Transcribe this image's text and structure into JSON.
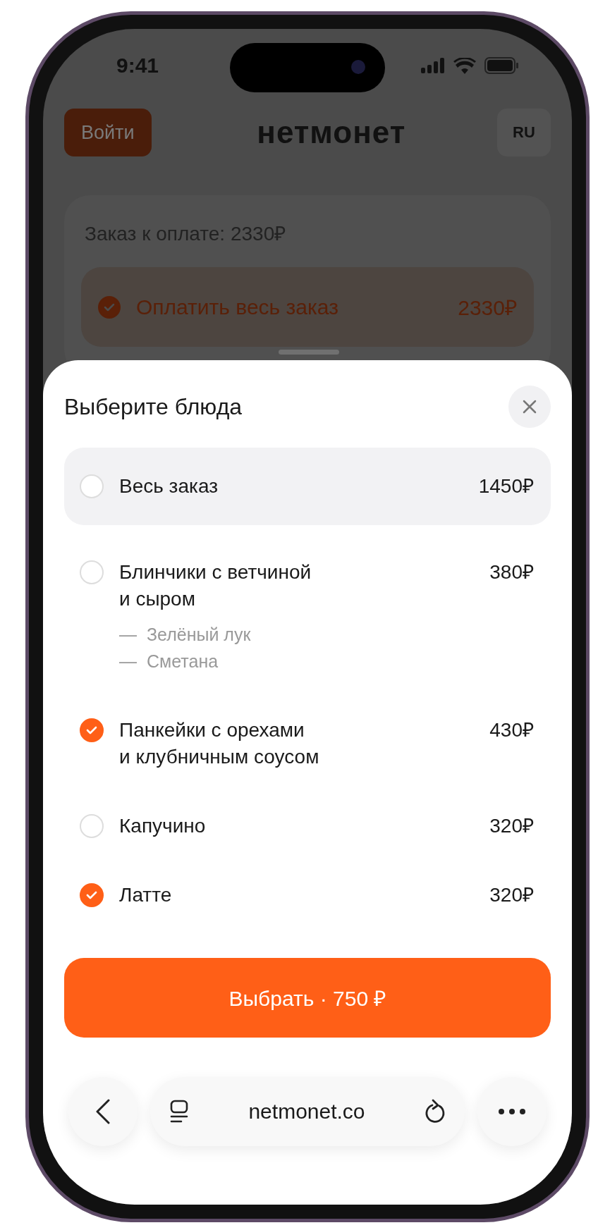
{
  "status_bar": {
    "time": "9:41"
  },
  "header": {
    "login_button": "Войти",
    "logo": "нетмонет",
    "language": "RU"
  },
  "order_card": {
    "title": "Заказ к оплате: 2330₽",
    "option": {
      "label": "Оплатить весь заказ",
      "amount": "2330₽",
      "checked": true
    }
  },
  "sheet": {
    "title": "Выберите блюда",
    "items": [
      {
        "kind": "all",
        "name": "Весь заказ",
        "price": "1450₽",
        "selected": false
      },
      {
        "kind": "dish",
        "name": "Блинчики с ветчиной\nи сыром",
        "price": "380₽",
        "selected": false,
        "modifiers": [
          "—",
          "Зелёный лук",
          "—",
          "Сметана"
        ]
      },
      {
        "kind": "dish",
        "name": "Панкейки с орехами\nи клубничным соусом",
        "price": "430₽",
        "selected": true
      },
      {
        "kind": "dish",
        "name": "Капучино",
        "price": "320₽",
        "selected": false
      },
      {
        "kind": "dish",
        "name": "Латте",
        "price": "320₽",
        "selected": true
      }
    ],
    "submit_button": "Выбрать · 750 ₽"
  },
  "browser_bar": {
    "url": "netmonet.co"
  }
}
